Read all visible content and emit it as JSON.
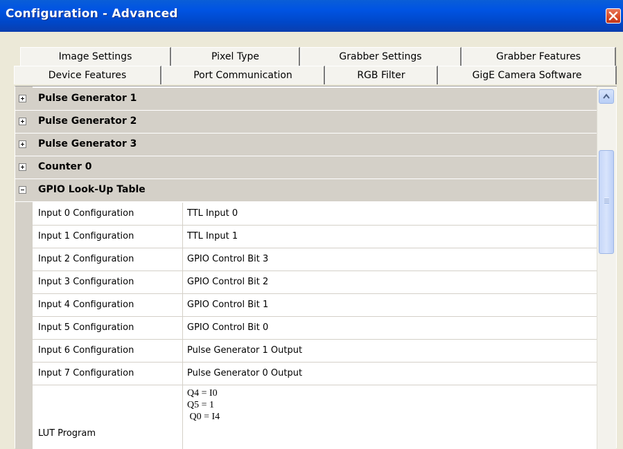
{
  "window": {
    "title": "Configuration - Advanced",
    "close_icon": "close-icon"
  },
  "tabs": {
    "back_row": [
      "Image Settings",
      "Pixel Type",
      "Grabber Settings",
      "Grabber Features"
    ],
    "front_row": [
      "Device Features",
      "Port Communication",
      "RGB Filter",
      "GigE Camera Software"
    ],
    "active": "Device Features"
  },
  "categories": [
    {
      "label": "Pulse Generator 1",
      "expanded": false
    },
    {
      "label": "Pulse Generator 2",
      "expanded": false
    },
    {
      "label": "Pulse Generator 3",
      "expanded": false
    },
    {
      "label": "Counter 0",
      "expanded": false
    },
    {
      "label": "GPIO Look-Up Table",
      "expanded": true
    }
  ],
  "properties": [
    {
      "name": "Input 0 Configuration",
      "value": "TTL Input 0"
    },
    {
      "name": "Input 1 Configuration",
      "value": "TTL Input 1"
    },
    {
      "name": "Input 2 Configuration",
      "value": "GPIO Control Bit 3"
    },
    {
      "name": "Input 3 Configuration",
      "value": "GPIO Control Bit 2"
    },
    {
      "name": "Input 4 Configuration",
      "value": "GPIO Control Bit 1"
    },
    {
      "name": "Input 5 Configuration",
      "value": "GPIO Control Bit 0"
    },
    {
      "name": "Input 6 Configuration",
      "value": "Pulse Generator 1 Output"
    },
    {
      "name": "Input 7 Configuration",
      "value": "Pulse Generator 0 Output"
    }
  ],
  "lut": {
    "name": "LUT Program",
    "value": "Q4 = I0\nQ5 = 1\n Q0 = I4"
  },
  "colors": {
    "titlebar": "#0054e3",
    "close_button": "#d84a26",
    "grid_background": "#d4d0c8"
  }
}
